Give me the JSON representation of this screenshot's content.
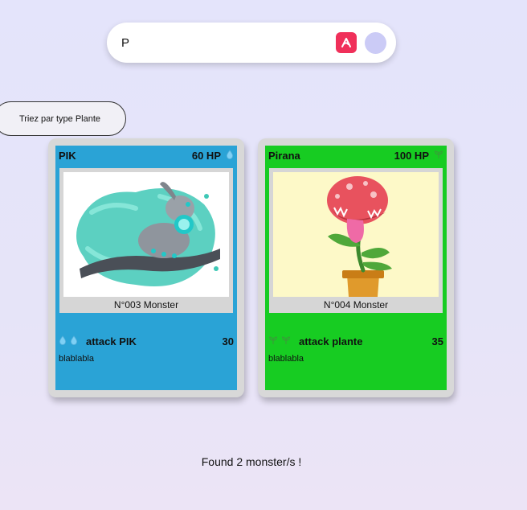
{
  "search": {
    "value": "P",
    "app_icon": "pdf-app-icon",
    "avatar": "avatar"
  },
  "sort_button": {
    "label": "Triez par type Plante"
  },
  "cards": [
    {
      "name": "PIK",
      "hp": "60 HP",
      "type_icon": "water-drop-icon",
      "color": "#2aa3d6",
      "number": "N°003 Monster",
      "attack": {
        "name": "attack PIK",
        "damage": "30",
        "cost_icons": [
          "water-drop-icon",
          "water-drop-icon"
        ]
      },
      "description": "blablabla"
    },
    {
      "name": "Pirana",
      "hp": "100 HP",
      "type_icon": "plant-sprout-icon",
      "color": "#17cc22",
      "number": "N°004 Monster",
      "attack": {
        "name": "attack plante",
        "damage": "35",
        "cost_icons": [
          "plant-sprout-icon",
          "plant-sprout-icon"
        ]
      },
      "description": "blablabla"
    }
  ],
  "footer": {
    "found_text": "Found 2 monster/s !"
  }
}
